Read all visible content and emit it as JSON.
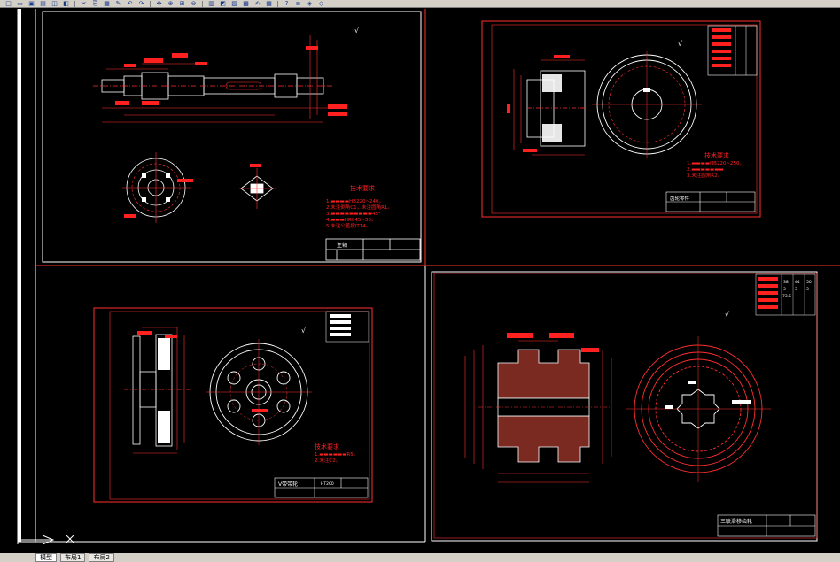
{
  "toolbar": {
    "icons": [
      "new-icon",
      "open-icon",
      "save-icon",
      "print-icon",
      "preview-icon",
      "publish-icon",
      "cut-icon",
      "copy-icon",
      "paste-icon",
      "match-properties-icon",
      "undo-icon",
      "redo-icon",
      "pan-icon",
      "zoom-realtime-icon",
      "zoom-window-icon",
      "zoom-previous-icon",
      "properties-icon",
      "design-center-icon",
      "tool-palettes-icon",
      "sheet-set-icon",
      "markup-icon",
      "calculator-icon",
      "help-icon",
      "layer-icon",
      "layer-state-icon",
      "layer-previous-icon"
    ]
  },
  "sheets": {
    "tl": {
      "notes_title": "技术要求",
      "notes": [
        "1.▬▬▬▬HB220~240。",
        "2.未注倒角C1，未注圆角R1。",
        "3.▬▬▬▬▬▬▬▬▬45°",
        "4.▬▬▬HRC45~50。",
        "5.未注公差按IT14。"
      ],
      "title_cell": "主轴"
    },
    "tr": {
      "notes_title": "技术要求",
      "notes": [
        "1.▬▬▬▬HB220~250。",
        "2.▬▬▬▬▬▬▬",
        "3.未注圆角R2。"
      ],
      "title_cell": "齿轮零件"
    },
    "bl": {
      "notes_title": "技术要求",
      "notes": [
        "1.▬▬▬▬▬▬R5。",
        "2.未注C2。"
      ],
      "title_cell": "V带带轮",
      "table_cell": "HT200"
    },
    "br": {
      "title_cell": "三联滑移齿轮",
      "params_rows": [
        [
          "z",
          "38",
          "44",
          "50"
        ],
        [
          "m",
          "3",
          "3",
          "3"
        ],
        [
          "",
          "",
          "",
          ""
        ],
        [
          "",
          "",
          "",
          ""
        ],
        [
          "",
          "",
          "",
          ""
        ]
      ],
      "params_extra": "73.5"
    }
  },
  "layout_tabs": [
    "模型",
    "布局1",
    "布局2"
  ],
  "colors": {
    "background": "#000000",
    "border": "#ff0000",
    "geometry": "#ffffff",
    "dimension": "#ff3030",
    "text": "#ff2020",
    "ui": "#d4d0c8"
  }
}
